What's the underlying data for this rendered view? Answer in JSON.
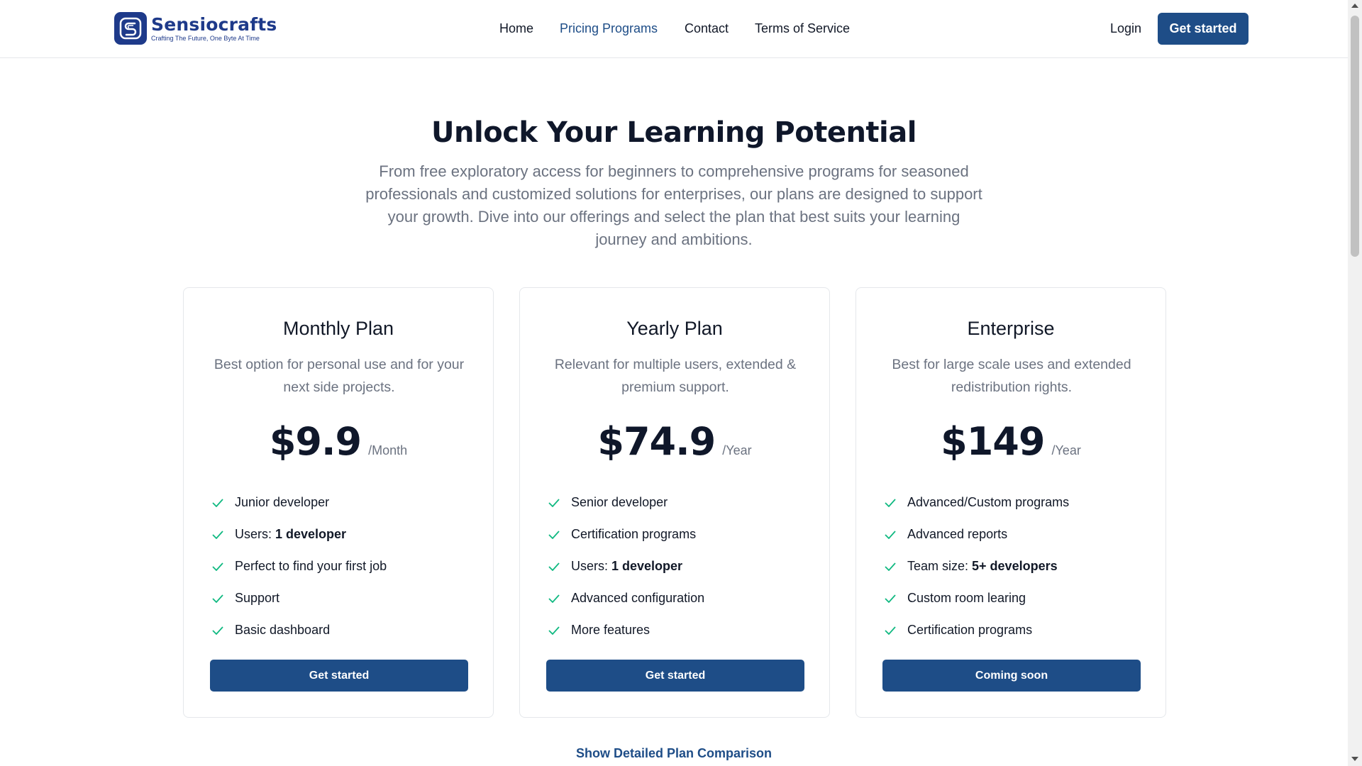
{
  "brand": {
    "name": "Sensiocrafts",
    "tagline": "Crafting The Future, One Byte At Time"
  },
  "nav": {
    "home": "Home",
    "pricing": "Pricing Programs",
    "contact": "Contact",
    "terms": "Terms of Service"
  },
  "header": {
    "login": "Login",
    "cta": "Get started"
  },
  "hero": {
    "title": "Unlock Your Learning Potential",
    "subtitle": "From free exploratory access for beginners to comprehensive programs for seasoned professionals and customized solutions for enterprises, our plans are designed to support your growth. Dive into our offerings and select the plan that best suits your learning journey and ambitions."
  },
  "plans": [
    {
      "title": "Monthly Plan",
      "description": "Best option for personal use and for your next side projects.",
      "price": "$9.9",
      "period": "/Month",
      "features": [
        {
          "text": "Junior developer",
          "bold": ""
        },
        {
          "text": "Users:",
          "bold": "1 developer"
        },
        {
          "text": "Perfect to find your first job",
          "bold": ""
        },
        {
          "text": "Support",
          "bold": ""
        },
        {
          "text": "Basic dashboard",
          "bold": ""
        }
      ],
      "button": "Get started"
    },
    {
      "title": "Yearly Plan",
      "description": "Relevant for multiple users, extended & premium support.",
      "price": "$74.9",
      "period": "/Year",
      "features": [
        {
          "text": "Senior developer",
          "bold": ""
        },
        {
          "text": "Certification programs",
          "bold": ""
        },
        {
          "text": "Users:",
          "bold": "1 developer"
        },
        {
          "text": "Advanced configuration",
          "bold": ""
        },
        {
          "text": "More features",
          "bold": ""
        }
      ],
      "button": "Get started"
    },
    {
      "title": "Enterprise",
      "description": "Best for large scale uses and extended redistribution rights.",
      "price": "$149",
      "period": "/Year",
      "features": [
        {
          "text": "Advanced/Custom programs",
          "bold": ""
        },
        {
          "text": "Advanced reports",
          "bold": ""
        },
        {
          "text": "Team size:",
          "bold": "5+ developers"
        },
        {
          "text": "Custom room learing",
          "bold": ""
        },
        {
          "text": "Certification programs",
          "bold": ""
        }
      ],
      "button": "Coming soon"
    }
  ],
  "comparison_link": "Show Detailed Plan Comparison",
  "icons": {
    "check": "check-icon",
    "logo": "sensiocrafts-logo-icon"
  },
  "colors": {
    "primary": "#1e4d87",
    "brand": "#1e3a8a",
    "check": "#10b981"
  }
}
